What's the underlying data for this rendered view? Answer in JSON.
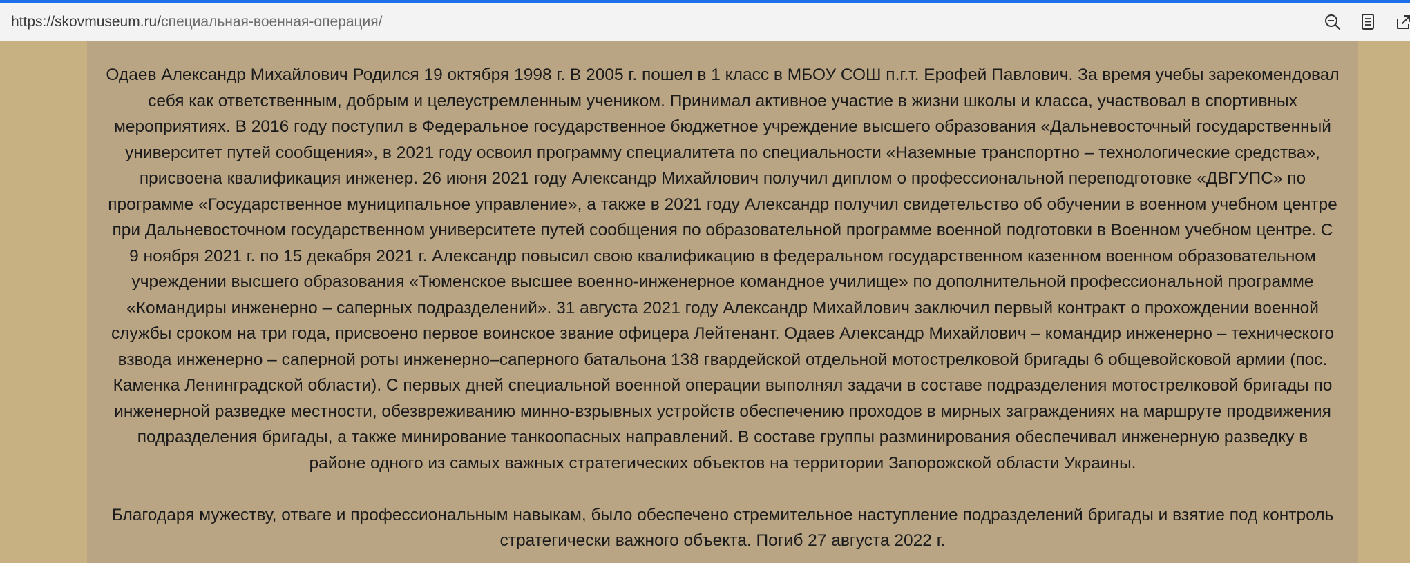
{
  "address_bar": {
    "url_domain": "https://skovmuseum.ru/",
    "url_path": "специальная-военная-операция/",
    "icons": [
      "zoom-out-icon",
      "reader-mode-icon",
      "share-icon"
    ]
  },
  "article": {
    "paragraph_1": "Одаев Александр Михайлович Родился 19 октября 1998 г. В 2005 г. пошел в 1 класс в МБОУ СОШ п.г.т. Ерофей Павлович. За время учебы зарекомендовал\nсебя как ответственным, добрым и целеустремленным учеником. Принимал активное участие в жизни школы и класса, участвовал в спортивных\nмероприятиях. В 2016 году поступил в Федеральное государственное бюджетное учреждение высшего образования «Дальневосточный государственный\nуниверситет путей сообщения», в 2021 году освоил программу специалитета по специальности «Наземные транспортно – технологические средства»,\nприсвоена квалификация инженер. 26 июня 2021 году Александр Михайлович получил диплом о профессиональной переподготовке «ДВГУПС» по\nпрограмме «Государственное муниципальное управление», а также в 2021 году Александр получил свидетельство об обучении в военном учебном центре\nпри Дальневосточном государственном университете путей сообщения по образовательной программе военной подготовки в Военном учебном центре. С\n9 ноября 2021 г. по 15 декабря 2021 г. Александр повысил свою квалификацию в федеральном государственном казенном военном образовательном\nучреждении высшего образования «Тюменское высшее военно-инженерное командное училище» по дополнительной профессиональной программе\n«Командиры инженерно – саперных подразделений». 31 августа 2021 году Александр Михайлович заключил первый контракт о прохождении военной\nслужбы сроком на три года, присвоено первое воинское звание офицера Лейтенант. Одаев Александр Михайлович – командир инженерно – технического\nвзвода инженерно – саперной роты инженерно–саперного батальона 138 гвардейской отдельной мотострелковой бригады 6 общевойсковой армии (пос.\nКаменка Ленинградской области). С  первых дней специальной военной операции выполнял задачи в составе подразделения мотострелковой бригады по\nинженерной разведке местности, обезвреживанию минно-взрывных устройств  обеспечению проходов в мирных заграждениях на маршруте продвижения\nподразделения бригады, а также минирование танкоопасных направлений. В составе группы разминирования обеспечивал инженерную разведку  в\nрайоне одного из самых важных стратегических объектов на территории Запорожской области Украины.",
    "paragraph_2": "Благодаря мужеству, отваге и профессиональным навыкам, было обеспечено стремительное наступление подразделений бригады и взятие под контроль\nстратегически важного объекта. Погиб  27 августа 2022 г."
  },
  "colors": {
    "page_background": "#c7b183",
    "content_background": "#b9a484",
    "text": "#1b1b1b",
    "accent": "#1f6feb"
  }
}
